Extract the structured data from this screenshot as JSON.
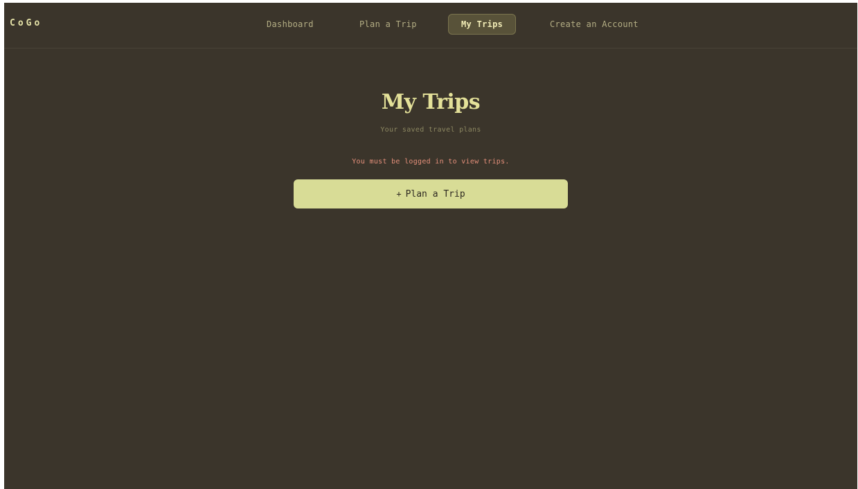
{
  "header": {
    "brand": "CoGo",
    "nav": {
      "dashboard": "Dashboard",
      "plan_a_trip": "Plan a Trip",
      "my_trips": "My Trips",
      "create_account": "Create an Account"
    },
    "active_nav": "My Trips"
  },
  "main": {
    "title": "My Trips",
    "subtitle": "Your saved travel plans",
    "error": "You must be logged in to view trips.",
    "plan_button": {
      "icon_glyph": "+",
      "label": "Plan a Trip"
    }
  },
  "colors": {
    "background": "#3b352b",
    "accent": "#d8dc96",
    "error": "#e6907b",
    "title": "#e4e199"
  }
}
